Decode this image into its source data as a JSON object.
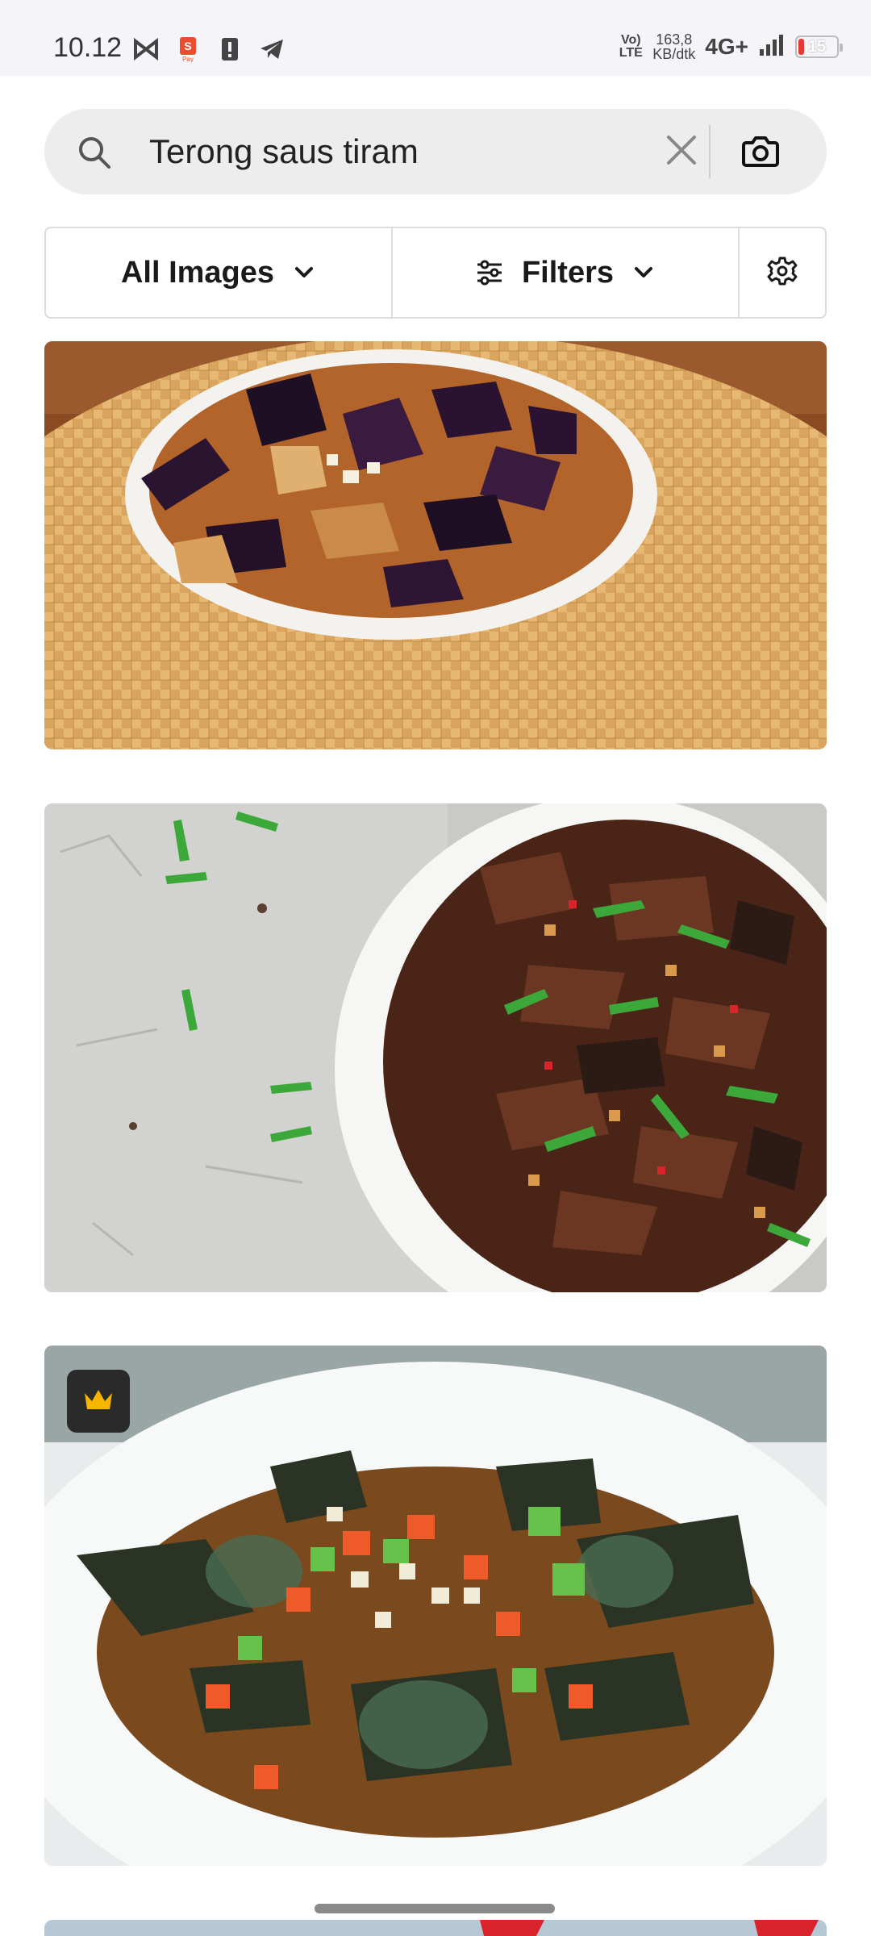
{
  "status_bar": {
    "time": "10.12",
    "left_icons": [
      "capcut-icon",
      "shopeepay-icon",
      "alert-icon",
      "telegram-icon"
    ],
    "volte": "Vo) LTE",
    "speed_value": "163,8",
    "speed_unit": "KB/dtk",
    "network": "4G+",
    "battery": "15",
    "battery_color": "#e53935"
  },
  "search": {
    "query": "Terong saus tiram",
    "placeholder": "Search"
  },
  "filters": {
    "type_label": "All Images",
    "filters_label": "Filters"
  },
  "results": [
    {
      "subject": "braised eggplant in white plate on woven mat",
      "premium": false
    },
    {
      "subject": "stir-fried eggplant with scallions on grey stone",
      "premium": false
    },
    {
      "subject": "century egg with chopped peppers in white bowl",
      "premium": true
    },
    {
      "subject": "partially visible image",
      "premium": false
    }
  ],
  "colors": {
    "background": "#ffffff",
    "status_bar": "#f4f4f9",
    "search_bg": "#ededed",
    "premium_crown": "#f7b500"
  }
}
